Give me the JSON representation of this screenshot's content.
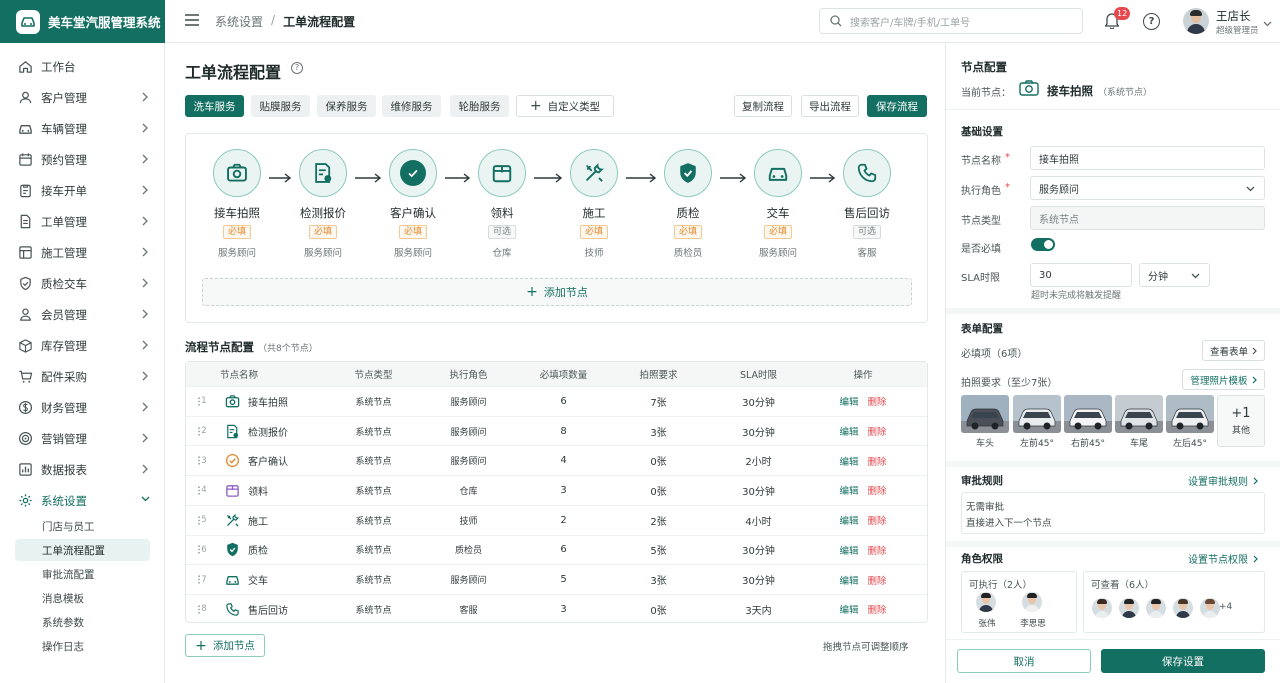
{
  "app": {
    "name": "美车堂汽服管理系统"
  },
  "colors": {
    "brand": "#136f62",
    "accent_orange": "#e08a2e",
    "danger": "#e5484d",
    "badge": "#e5484d"
  },
  "sidebar": {
    "items": [
      {
        "label": "工作台",
        "icon": "home-icon"
      },
      {
        "label": "客户管理",
        "icon": "user-icon"
      },
      {
        "label": "车辆管理",
        "icon": "car-icon"
      },
      {
        "label": "预约管理",
        "icon": "calendar-icon"
      },
      {
        "label": "接车开单",
        "icon": "clipboard-icon"
      },
      {
        "label": "工单管理",
        "icon": "document-icon"
      },
      {
        "label": "施工管理",
        "icon": "layout-icon"
      },
      {
        "label": "质检交车",
        "icon": "shield-icon"
      },
      {
        "label": "会员管理",
        "icon": "member-icon"
      },
      {
        "label": "库存管理",
        "icon": "box-icon"
      },
      {
        "label": "配件采购",
        "icon": "cart-icon"
      },
      {
        "label": "财务管理",
        "icon": "money-icon"
      },
      {
        "label": "营销管理",
        "icon": "target-icon"
      },
      {
        "label": "数据报表",
        "icon": "chart-icon"
      },
      {
        "label": "系统设置",
        "icon": "gear-icon"
      }
    ],
    "sub_items": [
      "门店与员工",
      "工单流程配置",
      "审批流配置",
      "消息模板",
      "系统参数",
      "操作日志"
    ]
  },
  "topbar": {
    "breadcrumb_parent": "系统设置",
    "breadcrumb_sep": "/",
    "breadcrumb_current": "工单流程配置",
    "search_placeholder": "搜索客户/车牌/手机/工单号",
    "notification_count": "12",
    "user_name": "王店长",
    "user_role": "超级管理员"
  },
  "main": {
    "title": "工单流程配置",
    "tabs": [
      "洗车服务",
      "贴膜服务",
      "保养服务",
      "维修服务",
      "轮胎服务"
    ],
    "custom_type": "自定义类型",
    "actions": {
      "copy": "复制流程",
      "export": "导出流程",
      "save": "保存流程"
    },
    "flow_nodes": [
      {
        "name": "接车拍照",
        "tag": "必填",
        "required": true,
        "role": "服务顾问",
        "icon": "camera-icon"
      },
      {
        "name": "检测报价",
        "tag": "必填",
        "required": true,
        "role": "服务顾问",
        "icon": "inspection-report-icon"
      },
      {
        "name": "客户确认",
        "tag": "必填",
        "required": true,
        "role": "服务顾问",
        "icon": "check-circle-icon"
      },
      {
        "name": "领料",
        "tag": "可选",
        "required": false,
        "role": "仓库",
        "icon": "package-icon"
      },
      {
        "name": "施工",
        "tag": "必填",
        "required": true,
        "role": "技师",
        "icon": "tools-icon"
      },
      {
        "name": "质检",
        "tag": "必填",
        "required": true,
        "role": "质检员",
        "icon": "shield-check-icon"
      },
      {
        "name": "交车",
        "tag": "必填",
        "required": true,
        "role": "服务顾问",
        "icon": "car-icon"
      },
      {
        "name": "售后回访",
        "tag": "可选",
        "required": false,
        "role": "客服",
        "icon": "phone-icon"
      }
    ],
    "add_node": "添加节点",
    "table_title": "流程节点配置",
    "table_count": "（共8个节点）",
    "table_headers": [
      "节点名称",
      "节点类型",
      "执行角色",
      "必填项数量",
      "拍照要求",
      "SLA时限",
      "操作"
    ],
    "table_rows": [
      {
        "idx": "1",
        "name": "接车拍照",
        "type": "系统节点",
        "role": "服务顾问",
        "required_count": "6",
        "photos": "7张",
        "sla": "30分钟",
        "icon": "camera-icon"
      },
      {
        "idx": "2",
        "name": "检测报价",
        "type": "系统节点",
        "role": "服务顾问",
        "required_count": "8",
        "photos": "3张",
        "sla": "30分钟",
        "icon": "inspection-report-icon"
      },
      {
        "idx": "3",
        "name": "客户确认",
        "type": "系统节点",
        "role": "服务顾问",
        "required_count": "4",
        "photos": "0张",
        "sla": "2小时",
        "icon": "check-circle-icon"
      },
      {
        "idx": "4",
        "name": "领料",
        "type": "系统节点",
        "role": "仓库",
        "required_count": "3",
        "photos": "0张",
        "sla": "30分钟",
        "icon": "package-icon"
      },
      {
        "idx": "5",
        "name": "施工",
        "type": "系统节点",
        "role": "技师",
        "required_count": "2",
        "photos": "2张",
        "sla": "4小时",
        "icon": "tools-icon"
      },
      {
        "idx": "6",
        "name": "质检",
        "type": "系统节点",
        "role": "质检员",
        "required_count": "6",
        "photos": "5张",
        "sla": "30分钟",
        "icon": "shield-check-icon"
      },
      {
        "idx": "7",
        "name": "交车",
        "type": "系统节点",
        "role": "服务顾问",
        "required_count": "5",
        "photos": "3张",
        "sla": "30分钟",
        "icon": "car-icon"
      },
      {
        "idx": "8",
        "name": "售后回访",
        "type": "系统节点",
        "role": "客服",
        "required_count": "3",
        "photos": "0张",
        "sla": "3天内",
        "icon": "phone-icon"
      }
    ],
    "edit_label": "编辑",
    "delete_label": "删除",
    "add_node_bottom": "添加节点",
    "drag_hint": "拖拽节点可调整顺序"
  },
  "panel": {
    "title": "节点配置",
    "current_label": "当前节点：",
    "current_node": "接车拍照",
    "current_type": "（系统节点）",
    "basic_title": "基础设置",
    "name_label": "节点名称",
    "name_value": "接车拍照",
    "role_label": "执行角色",
    "role_value": "服务顾问",
    "type_label": "节点类型",
    "type_value": "系统节点",
    "required_label": "是否必填",
    "required_on": true,
    "sla_label": "SLA时限",
    "sla_value": "30",
    "sla_unit": "分钟",
    "sla_hint": "超时未完成将触发提醒",
    "required_mark": "*",
    "form_title": "表单配置",
    "required_items": "必填项（6项）",
    "view_form": "查看表单",
    "photo_req": "拍照要求（至少7张）",
    "photo_template": "管理照片模板",
    "photos": [
      "车头",
      "左前45°",
      "右前45°",
      "车尾",
      "左后45°"
    ],
    "photo_more": "+1",
    "photo_more_label": "其他",
    "approval_title": "审批规则",
    "approval_link": "设置审批规则",
    "approval_line1": "无需审批",
    "approval_line2": "直接进入下一个节点",
    "perm_title": "角色权限",
    "perm_link": "设置节点权限",
    "can_execute": "可执行（2人）",
    "executors": [
      "张伟",
      "李思思"
    ],
    "can_view": "可查看（6人）",
    "viewers_more": "+4",
    "cancel": "取消",
    "save": "保存设置"
  }
}
